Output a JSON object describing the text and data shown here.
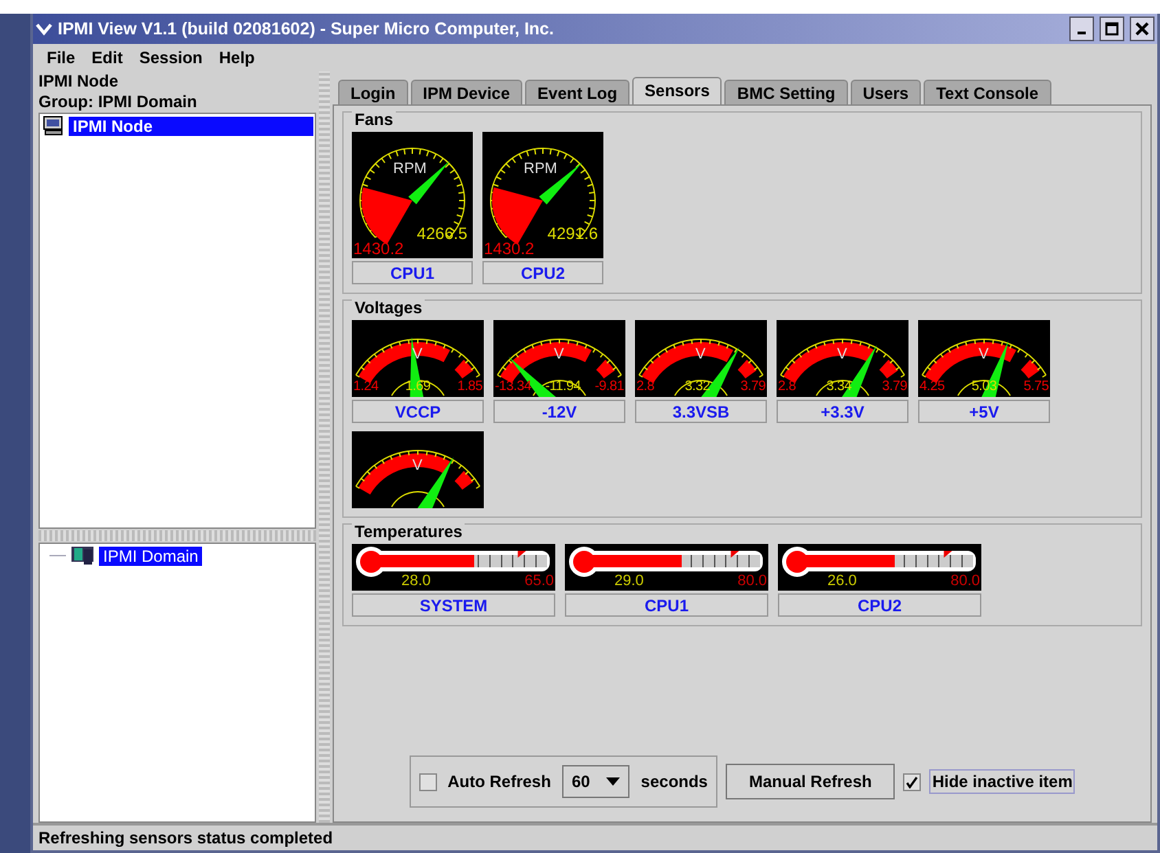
{
  "window": {
    "title": "IPMI View V1.1 (build 02081602) - Super Micro Computer, Inc."
  },
  "menu": [
    "File",
    "Edit",
    "Session",
    "Help"
  ],
  "node_info": {
    "name": "IPMI Node",
    "group": "Group: IPMI Domain"
  },
  "node_list": [
    {
      "label": "IPMI Node",
      "selected": true
    }
  ],
  "tree": [
    {
      "label": "IPMI Domain",
      "selected": true
    }
  ],
  "tabs": [
    {
      "label": "Login",
      "selected": false
    },
    {
      "label": "IPM Device",
      "selected": false
    },
    {
      "label": "Event Log",
      "selected": false
    },
    {
      "label": "Sensors",
      "selected": true
    },
    {
      "label": "BMC Setting",
      "selected": false
    },
    {
      "label": "Users",
      "selected": false
    },
    {
      "label": "Text Console",
      "selected": false
    }
  ],
  "sections": [
    {
      "kind": "fans",
      "title": "Fans",
      "sensors": [
        {
          "name": "CPU1",
          "unit": "RPM",
          "value": "4266.5",
          "limit": "1430.2"
        },
        {
          "name": "CPU2",
          "unit": "RPM",
          "value": "4291.6",
          "limit": "1430.2"
        }
      ]
    },
    {
      "kind": "voltages",
      "title": "Voltages",
      "sensors": [
        {
          "name": "VCCP",
          "unit": "V",
          "low": "1.24",
          "value": "1.69",
          "high": "1.85"
        },
        {
          "name": "-12V",
          "unit": "V",
          "low": "-13.34",
          "value": "-11.94",
          "high": "-9.81"
        },
        {
          "name": "3.3VSB",
          "unit": "V",
          "low": "2.8",
          "value": "3.32",
          "high": "3.79"
        },
        {
          "name": "+3.3V",
          "unit": "V",
          "low": "2.8",
          "value": "3.34",
          "high": "3.79"
        },
        {
          "name": "+5V",
          "unit": "V",
          "low": "4.25",
          "value": "5.03",
          "high": "5.75"
        },
        {
          "unit": "V"
        }
      ]
    },
    {
      "kind": "temperatures",
      "title": "Temperatures",
      "sensors": [
        {
          "name": "SYSTEM",
          "value": "28.0",
          "limit": "65.0",
          "level": 0.55
        },
        {
          "name": "CPU1",
          "value": "29.0",
          "limit": "80.0",
          "level": 0.52
        },
        {
          "name": "CPU2",
          "value": "26.0",
          "limit": "80.0",
          "level": 0.52
        }
      ]
    }
  ],
  "controls": {
    "auto_refresh": {
      "label": "Auto Refresh",
      "checked": false
    },
    "interval": "60",
    "interval_unit": "seconds",
    "refresh_button": "Manual Refresh",
    "hide_inactive": {
      "label": "Hide inactive item",
      "checked": true
    }
  },
  "status_bar": "Refreshing sensors status completed"
}
